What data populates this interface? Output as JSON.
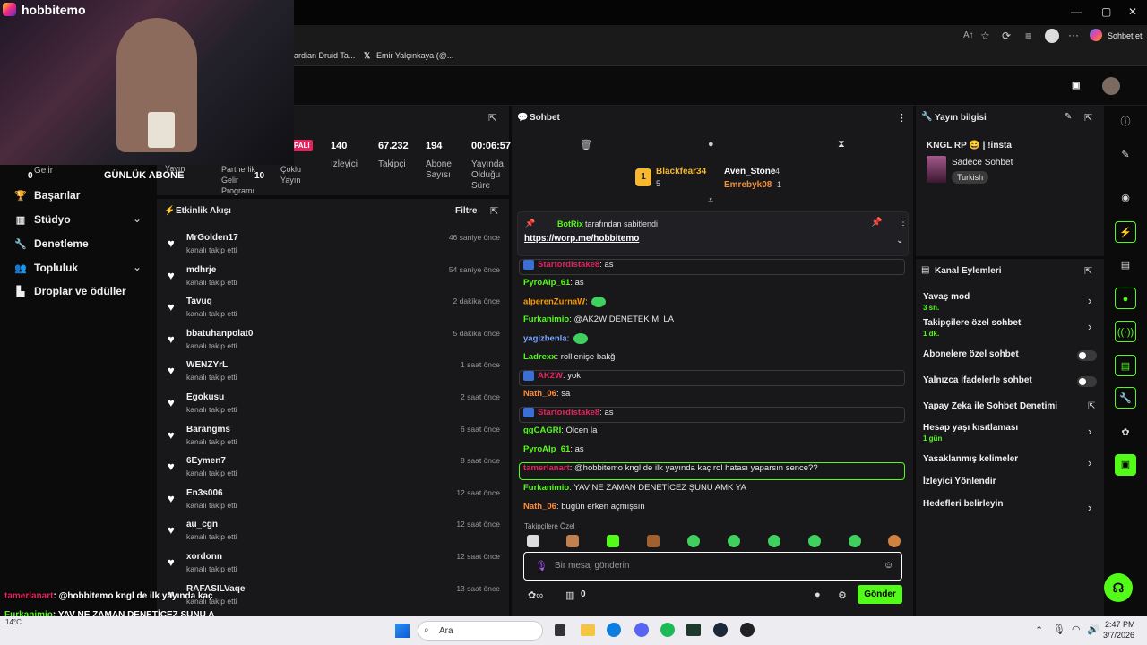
{
  "browser": {
    "chat_btn": "Sohbet et",
    "bookmarks": [
      "ardian Druid Ta...",
      "Emir Yalçınkaya (@..."
    ]
  },
  "webcam": {
    "name": "hobbitemo"
  },
  "overlay_labels": {
    "gelir": "Gelir",
    "gelir_val": "0",
    "abone": "GÜNLÜK ABONE",
    "yayin": "Yayın",
    "partner_label": "Partnerlik Gelir Programı",
    "partner_val": "10",
    "coklu": "Çoklu Yayın"
  },
  "nav": {
    "items": [
      {
        "label": "Başarılar",
        "icon": "trophy-icon"
      },
      {
        "label": "Stüdyo",
        "icon": "studio-icon"
      },
      {
        "label": "Denetleme",
        "icon": "wrench-icon"
      },
      {
        "label": "Topluluk",
        "icon": "people-icon"
      },
      {
        "label": "Droplar ve ödüller",
        "icon": "gift-icon"
      }
    ]
  },
  "stats": {
    "status": "PALI",
    "izleyici_val": "140",
    "izleyici": "İzleyici",
    "takipci_val": "67.232",
    "takipci": "Takipçi",
    "abone_val": "194",
    "abone": "Abone Sayısı",
    "sure_val": "00:06:57",
    "sure": "Yayında Olduğu Süre"
  },
  "events": {
    "title": "Etkinlik Akışı",
    "filter": "Filtre",
    "items": [
      {
        "name": "MrGolden17",
        "sub": "kanalı takip etti",
        "time": "46 saniye önce"
      },
      {
        "name": "mdhrje",
        "sub": "kanalı takip etti",
        "time": "54 saniye önce"
      },
      {
        "name": "Tavuq",
        "sub": "kanalı takip etti",
        "time": "2 dakika önce"
      },
      {
        "name": "bbatuhanpolat0",
        "sub": "kanalı takip etti",
        "time": "5 dakika önce"
      },
      {
        "name": "WENZYrL",
        "sub": "kanalı takip etti",
        "time": "1 saat önce"
      },
      {
        "name": "Egokusu",
        "sub": "kanalı takip etti",
        "time": "2 saat önce"
      },
      {
        "name": "Barangms",
        "sub": "kanalı takip etti",
        "time": "6 saat önce"
      },
      {
        "name": "6Eymen7",
        "sub": "kanalı takip etti",
        "time": "8 saat önce"
      },
      {
        "name": "En3s006",
        "sub": "kanalı takip etti",
        "time": "12 saat önce"
      },
      {
        "name": "au_cgn",
        "sub": "kanalı takip etti",
        "time": "12 saat önce"
      },
      {
        "name": "xordonn",
        "sub": "kanalı takip etti",
        "time": "12 saat önce"
      },
      {
        "name": "RAFASILVaqe",
        "sub": "kanalı takip etti",
        "time": "13 saat önce"
      }
    ]
  },
  "chat": {
    "title": "Sohbet",
    "top": [
      {
        "name": "Blackfear34",
        "count": "5"
      },
      {
        "name": "Aven_Stone",
        "count": "4"
      },
      {
        "name": "Emrebyk08",
        "count": "1"
      }
    ],
    "pinned_by": "BotRix",
    "pinned_suffix": "tarafından sabitlendi",
    "pinned_link": "https://worp.me/hobbitemo",
    "messages": [
      {
        "user": "Startordistake8",
        "text": "as",
        "color": "#e0245e",
        "box": true
      },
      {
        "user": "PyroAlp_61",
        "text": "as",
        "color": "#53fc18"
      },
      {
        "user": "alperenZurnaW",
        "text": "",
        "color": "#ff9900"
      },
      {
        "user": "Furkanimio",
        "text": "@AK2W DENETEK Mİ LA",
        "color": "#53fc18"
      },
      {
        "user": "yagizbenla",
        "text": "",
        "color": "#7aa7ff"
      },
      {
        "user": "Ladrexx",
        "text": "rolllenişe bakğ",
        "color": "#53fc18"
      },
      {
        "user": "AK2W",
        "text": "yok",
        "color": "#e0245e",
        "box": true
      },
      {
        "user": "Nath_06",
        "text": "sa",
        "color": "#ff8c3a"
      },
      {
        "user": "Startordistake8",
        "text": "as",
        "color": "#e0245e",
        "box": true
      },
      {
        "user": "ggCAGRI",
        "text": "Ölcen la",
        "color": "#53fc18"
      },
      {
        "user": "PyroAlp_61",
        "text": "as",
        "color": "#53fc18"
      },
      {
        "user": "tamerlanart",
        "text": "@hobbitemo kngl de ilk yayında kaç rol hatası yaparsın sence??",
        "color": "#e0245e",
        "boxg": true
      },
      {
        "user": "Furkanimio",
        "text": "YAV NE ZAMAN DENETİCEZ ŞUNU AMK YA",
        "color": "#53fc18"
      },
      {
        "user": "Nath_06",
        "text": "bugün erken açmışsın",
        "color": "#ff8c3a"
      }
    ],
    "followers_only": "Takipçilere Özel",
    "placeholder": "Bir mesaj gönderin",
    "count": "0",
    "send": "Gönder"
  },
  "info": {
    "title": "Yayın bilgisi",
    "stream_title": "KNGL RP 😄 | !insta",
    "category": "Sadece Sohbet",
    "tag": "Turkish"
  },
  "channel": {
    "title": "Kanal Eylemleri",
    "items": [
      {
        "label": "Yavaş mod",
        "sub": "3 sn.",
        "type": "chev"
      },
      {
        "label": "Takipçilere özel sohbet",
        "sub": "1 dk.",
        "type": "chev"
      },
      {
        "label": "Abonelere özel sohbet",
        "sub": "",
        "type": "toggle"
      },
      {
        "label": "Yalnızca ifadelerle sohbet",
        "sub": "",
        "type": "toggle"
      },
      {
        "label": "Yapay Zeka ile Sohbet Denetimi",
        "sub": "",
        "type": "ext"
      },
      {
        "label": "Hesap yaşı kısıtlaması",
        "sub": "1 gün",
        "type": "chev"
      },
      {
        "label": "Yasaklanmış kelimeler",
        "sub": "",
        "type": "chev"
      },
      {
        "label": "İzleyici Yönlendir",
        "sub": "",
        "type": "none"
      },
      {
        "label": "Hedefleri belirleyin",
        "sub": "",
        "type": "chev"
      }
    ]
  },
  "ticker": [
    {
      "user": "tamerlanart",
      "text": ": @hobbitemo kngl de ilk yayında kaç",
      "color": "#e0245e"
    },
    {
      "user": "Furkanimio",
      "text": ": YAV NE ZAMAN DENETİCEZ ŞUNU A",
      "color": "#53fc18"
    },
    {
      "user": "Nath_06",
      "text": " bugün erken açmışsın",
      "color": "#ff8c3a"
    }
  ],
  "taskbar": {
    "search": "Ara",
    "weather": "14°C",
    "time": "2:47 PM",
    "date": "3/7/2026"
  }
}
